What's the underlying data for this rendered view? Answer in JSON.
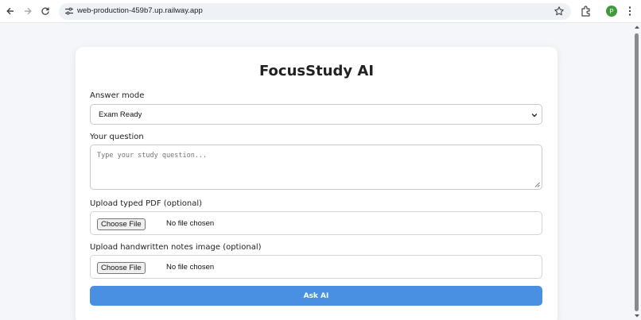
{
  "browser": {
    "url": "web-production-459b7.up.railway.app",
    "profile_initial": "P",
    "profile_color": "#3e9a3a"
  },
  "icons": {
    "back": "arrow-left-icon",
    "forward": "arrow-right-icon",
    "reload": "reload-icon",
    "site_info": "tune-icon",
    "bookmark": "star-icon",
    "extensions": "puzzle-icon",
    "menu": "kebab-menu-icon"
  },
  "page": {
    "title": "FocusStudy AI",
    "answer_mode": {
      "label": "Answer mode",
      "selected": "Exam Ready"
    },
    "question": {
      "label": "Your question",
      "placeholder": "Type your study question..."
    },
    "pdf_upload": {
      "label": "Upload typed PDF (optional)",
      "button": "Choose File",
      "status": "No file chosen"
    },
    "notes_upload": {
      "label": "Upload handwritten notes image (optional)",
      "button": "Choose File",
      "status": "No file chosen"
    },
    "submit_label": "Ask AI"
  },
  "colors": {
    "accent": "#4a90e2",
    "background": "#f4f6f9"
  }
}
